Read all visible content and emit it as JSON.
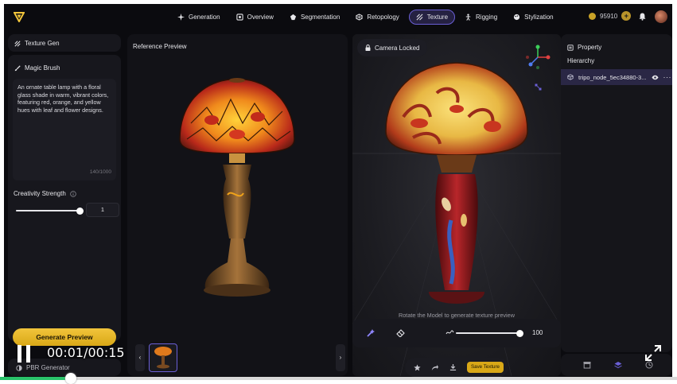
{
  "nav": {
    "items": [
      {
        "label": "Generation",
        "icon": "sparkle-icon"
      },
      {
        "label": "Overview",
        "icon": "overview-icon"
      },
      {
        "label": "Segmentation",
        "icon": "segment-icon"
      },
      {
        "label": "Retopology",
        "icon": "retopology-icon"
      },
      {
        "label": "Texture",
        "icon": "texture-icon",
        "active": true
      },
      {
        "label": "Rigging",
        "icon": "rigging-icon"
      },
      {
        "label": "Stylization",
        "icon": "stylization-icon"
      }
    ],
    "credits": "95910"
  },
  "left_panel": {
    "texture_gen_label": "Texture Gen",
    "magic_brush_label": "Magic Brush",
    "prompt_text": "An ornate table lamp with a floral glass shade in warm, vibrant colors, featuring red, orange, and yellow hues with leaf and flower designs.",
    "char_count": "140/1000",
    "creativity_label": "Creativity Strength",
    "creativity_value": "1",
    "creativity_level": 1.0,
    "generate_button": "Generate Preview",
    "pbr_label": "PBR Generator"
  },
  "reference": {
    "title": "Reference Preview",
    "prev_arrow": "‹",
    "next_arrow": "›"
  },
  "viewport": {
    "camera_label": "Camera Locked",
    "hint": "Rotate the Model to generate texture preview",
    "brush_size": "100",
    "brush_level": 1.0,
    "save_texture": "Save Texture"
  },
  "right_panel": {
    "property_label": "Property",
    "hierarchy_label": "Hierarchy",
    "node_name": "tripo_node_5ec34880-3..."
  },
  "video": {
    "timecode": "00:01/00:15",
    "progress": 0.105
  },
  "colors": {
    "accent": "#6a5fd6",
    "gold": "#d9a817",
    "progress": "#29c36a"
  }
}
